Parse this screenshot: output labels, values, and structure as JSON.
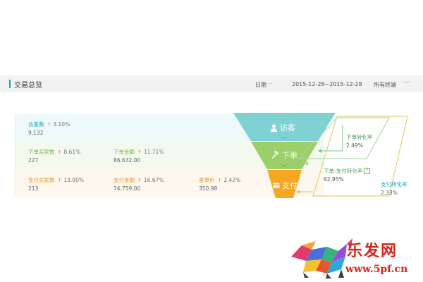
{
  "header": {
    "title": "交易总览",
    "date_label": "日期",
    "date_range": "2015-12-28~2015-12-28",
    "terminal": "所有终端"
  },
  "metrics": {
    "visitors": {
      "name": "访客数",
      "pct": "3.10%",
      "value": "9,132"
    },
    "order_buyers": {
      "name": "下单买家数",
      "pct": "8.61%",
      "value": "227"
    },
    "order_amount": {
      "name": "下单金额",
      "pct": "11.71%",
      "value": "86,632.00"
    },
    "pay_buyers": {
      "name": "支付买家数",
      "pct": "13.90%",
      "value": "213"
    },
    "pay_amount": {
      "name": "支付金额",
      "pct": "16.67%",
      "value": "74,759.00"
    },
    "avg_price": {
      "name": "客单价",
      "pct": "2.42%",
      "value": "350.98"
    }
  },
  "funnel": {
    "visit": "访客",
    "order": "下单",
    "pay": "支付"
  },
  "rates": {
    "order_rate": {
      "name": "下单转化率",
      "value": "2.49%"
    },
    "order_pay_rate": {
      "name": "下单-支付转化率",
      "value": "92.95%",
      "help": "?"
    },
    "pay_rate": {
      "name": "支付转化率",
      "value": "2.33%"
    }
  },
  "colors": {
    "teal": "#7fd1d4",
    "green": "#9ccf6a",
    "orange": "#f5a623",
    "up_arrow": "#f06a6a"
  },
  "watermark": {
    "text": "乐发网",
    "url": "www.5pf.cn"
  }
}
